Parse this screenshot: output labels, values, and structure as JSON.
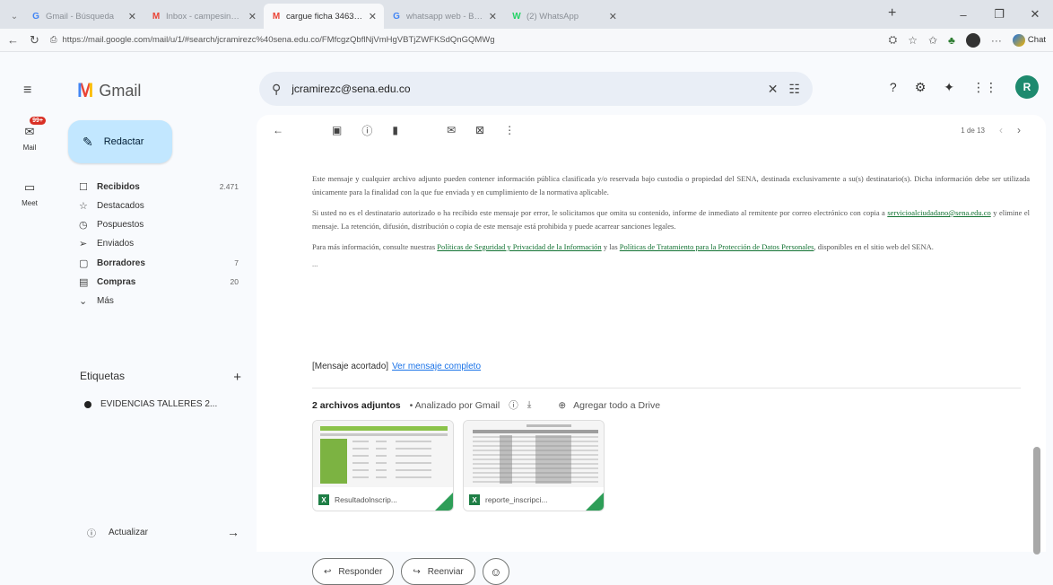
{
  "browser": {
    "tabs": [
      {
        "title": "Gmail - Búsqueda",
        "favicon": "G",
        "active": false
      },
      {
        "title": "Inbox - campesinapanaderia",
        "favicon": "M",
        "active": false
      },
      {
        "title": "cargue ficha 3463050 - rafeb",
        "favicon": "M",
        "active": true
      },
      {
        "title": "whatsapp web - Búsqueda",
        "favicon": "G",
        "active": false
      },
      {
        "title": "(2) WhatsApp",
        "favicon": "W",
        "active": false
      }
    ],
    "url": "https://mail.google.com/mail/u/1/#search/jcramirezc%40sena.edu.co/FMfcgzQbflNjVmHgVBTjZWFKSdQnGQMWg",
    "chat_label": "Chat"
  },
  "gmail": {
    "product_name": "Gmail",
    "rail": {
      "mail_label": "Mail",
      "mail_badge": "99+",
      "meet_label": "Meet"
    },
    "search_value": "jcramirezc@sena.edu.co",
    "compose_label": "Redactar",
    "nav": [
      {
        "icon": "inbox-icon",
        "glyph": "☐",
        "label": "Recibidos",
        "count": "2.471",
        "bold": true
      },
      {
        "icon": "star-icon",
        "glyph": "☆",
        "label": "Destacados",
        "count": "",
        "bold": false
      },
      {
        "icon": "clock-icon",
        "glyph": "◷",
        "label": "Pospuestos",
        "count": "",
        "bold": false
      },
      {
        "icon": "send-icon",
        "glyph": "➢",
        "label": "Enviados",
        "count": "",
        "bold": false
      },
      {
        "icon": "draft-icon",
        "glyph": "▢",
        "label": "Borradores",
        "count": "7",
        "bold": true
      },
      {
        "icon": "bag-icon",
        "glyph": "▤",
        "label": "Compras",
        "count": "20",
        "bold": true
      },
      {
        "icon": "chevron-down-icon",
        "glyph": "⌄",
        "label": "Más",
        "count": "",
        "bold": false
      }
    ],
    "labels_title": "Etiquetas",
    "labels": [
      "EVIDENCIAS TALLERES 2..."
    ],
    "update_label": "Actualizar",
    "pager_text": "1 de 13"
  },
  "message": {
    "paragraph1": "Este mensaje y cualquier archivo adjunto pueden contener información pública clasificada y/o reservada bajo custodia o propiedad del SENA, destinada exclusivamente a su(s) destinatario(s). Dicha información debe ser utilizada únicamente para la finalidad con la que fue enviada y en cumplimiento de la normativa aplicable.",
    "paragraph2_a": "Si usted no es el destinatario autorizado o ha recibido este mensaje por error, le solicitamos que omita su contenido, informe de inmediato al remitente por correo electrónico con copia a",
    "paragraph2_link": "servicioalciudadano@sena.edu.co",
    "paragraph2_b": "y elimine el mensaje. La retención, difusión, distribución o copia de este mensaje está prohibida y puede acarrear sanciones legales.",
    "paragraph3_a": "Para más información, consulte nuestras",
    "paragraph3_link1": "Políticas de Seguridad y Privacidad de la Información",
    "paragraph3_mid": "y las",
    "paragraph3_link2": "Políticas de Tratamiento para la Protección de Datos Personales",
    "paragraph3_b": ", disponibles en el sitio web del SENA.",
    "ellipsis": "...",
    "clipped_label": "[Mensaje acortado]",
    "clipped_link": "Ver mensaje completo",
    "attachments_title": "2 archivos adjuntos",
    "scanned_text": "• Analizado por Gmail",
    "drive_label": "Agregar todo a Drive",
    "attachments": [
      {
        "name": "Resultadolnscrip...",
        "type_icon": "X"
      },
      {
        "name": "reporte_inscripci...",
        "type_icon": "X"
      }
    ],
    "reply_label": "Responder",
    "forward_label": "Reenviar"
  }
}
